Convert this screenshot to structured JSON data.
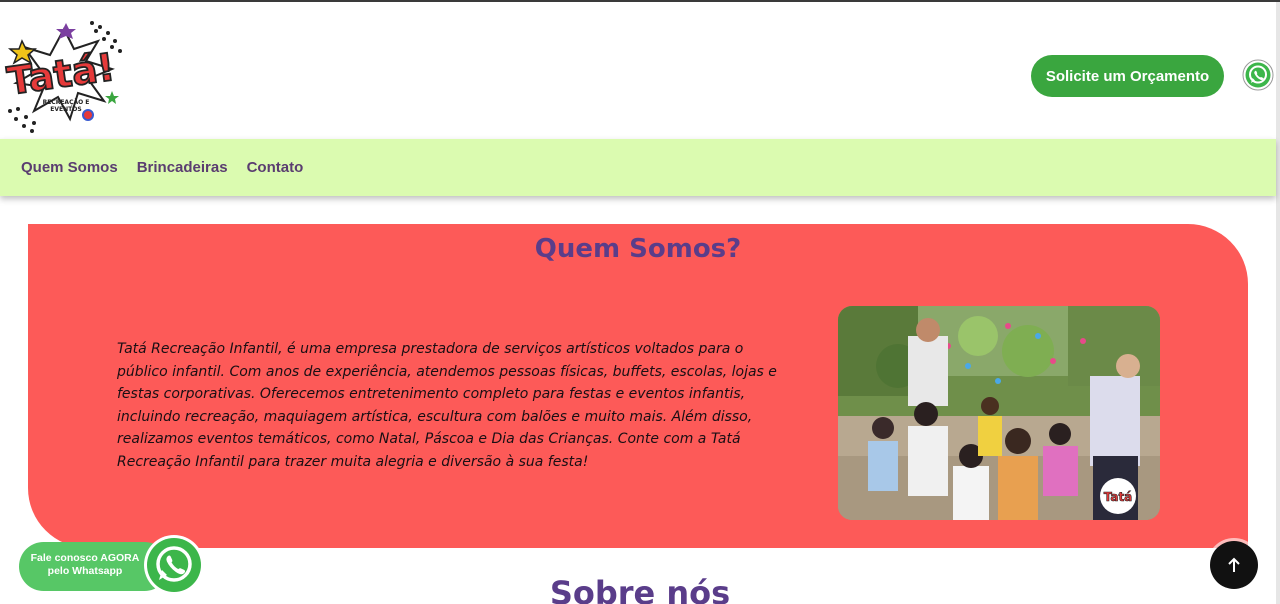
{
  "header": {
    "logo_text": "Tatá!",
    "logo_subtext": "RECREAÇÃO E EVENTOS",
    "cta_label": "Solicite um Orçamento"
  },
  "nav": {
    "items": [
      {
        "label": "Quem Somos"
      },
      {
        "label": "Brincadeiras"
      },
      {
        "label": "Contato"
      }
    ]
  },
  "about": {
    "title": "Quem Somos?",
    "body": "Tatá Recreação Infantil, é uma empresa prestadora de serviços artísticos voltados para o público infantil. Com anos de experiência, atendemos pessoas físicas, buffets, escolas, lojas e festas corporativas. Oferecemos entretenimento completo para festas e eventos infantis, incluindo recreação, maquiagem artística, escultura com balões e muito mais. Além disso, realizamos eventos temáticos, como Natal, Páscoa e Dia das Crianças. Conte com a Tatá Recreação Infantil para trazer muita alegria e diversão à sua festa!",
    "photo_badge": "Tatá"
  },
  "section2": {
    "title": "Sobre nós"
  },
  "whatsapp_float": {
    "line1": "Fale conosco AGORA",
    "line2": "pelo Whatsapp"
  },
  "colors": {
    "primary_green": "#3aa63f",
    "nav_bg": "#dbfbb0",
    "card_bg": "#fd5a58",
    "title_purple": "#5a3d8a",
    "whatsapp_green": "#57c766"
  }
}
